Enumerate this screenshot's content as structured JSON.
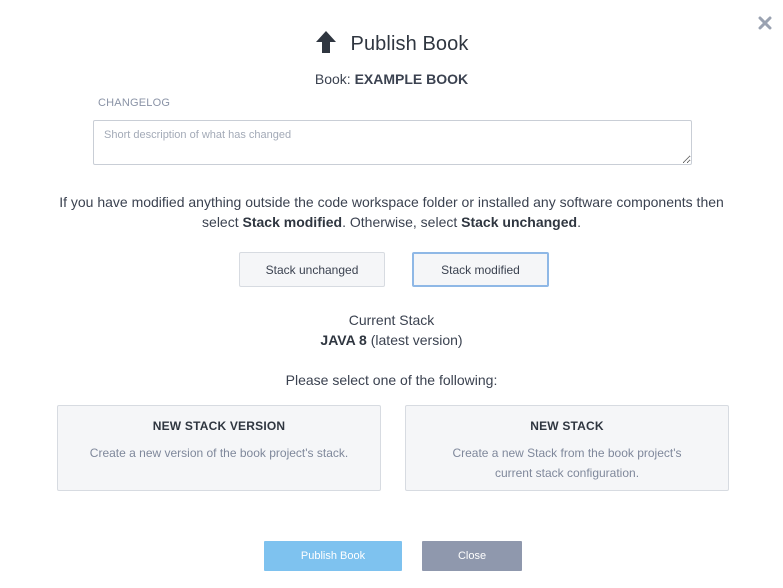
{
  "dialog": {
    "title": "Publish Book",
    "book_prefix": "Book: ",
    "book_name": "EXAMPLE BOOK"
  },
  "changelog": {
    "label": "CHANGELOG",
    "placeholder": "Short description of what has changed",
    "value": ""
  },
  "info": {
    "part1": "If you have modified anything outside the code workspace folder or installed any software components then select ",
    "bold1": "Stack modified",
    "part2": ". Otherwise, select ",
    "bold2": "Stack unchanged",
    "part3": "."
  },
  "stack_buttons": {
    "unchanged_label": "Stack unchanged",
    "modified_label": "Stack modified",
    "selected": "Stack modified"
  },
  "current_stack": {
    "label": "Current Stack",
    "name": "JAVA 8",
    "version_note": " (latest version)"
  },
  "select_prompt": "Please select one of the following:",
  "options": [
    {
      "title": "NEW STACK VERSION",
      "description": "Create a new version of the book project's stack."
    },
    {
      "title": "NEW STACK",
      "description": "Create a new Stack from the book project's current stack configuration."
    }
  ],
  "footer": {
    "publish_label": "Publish Book",
    "close_label": "Close"
  },
  "colors": {
    "publish_button": "#7ec2ef",
    "close_button": "#8f98ad",
    "selected_border": "#8fb8e6"
  },
  "icons": {
    "title_icon": "upload-arrow-icon",
    "dismiss_icon": "close-icon"
  }
}
